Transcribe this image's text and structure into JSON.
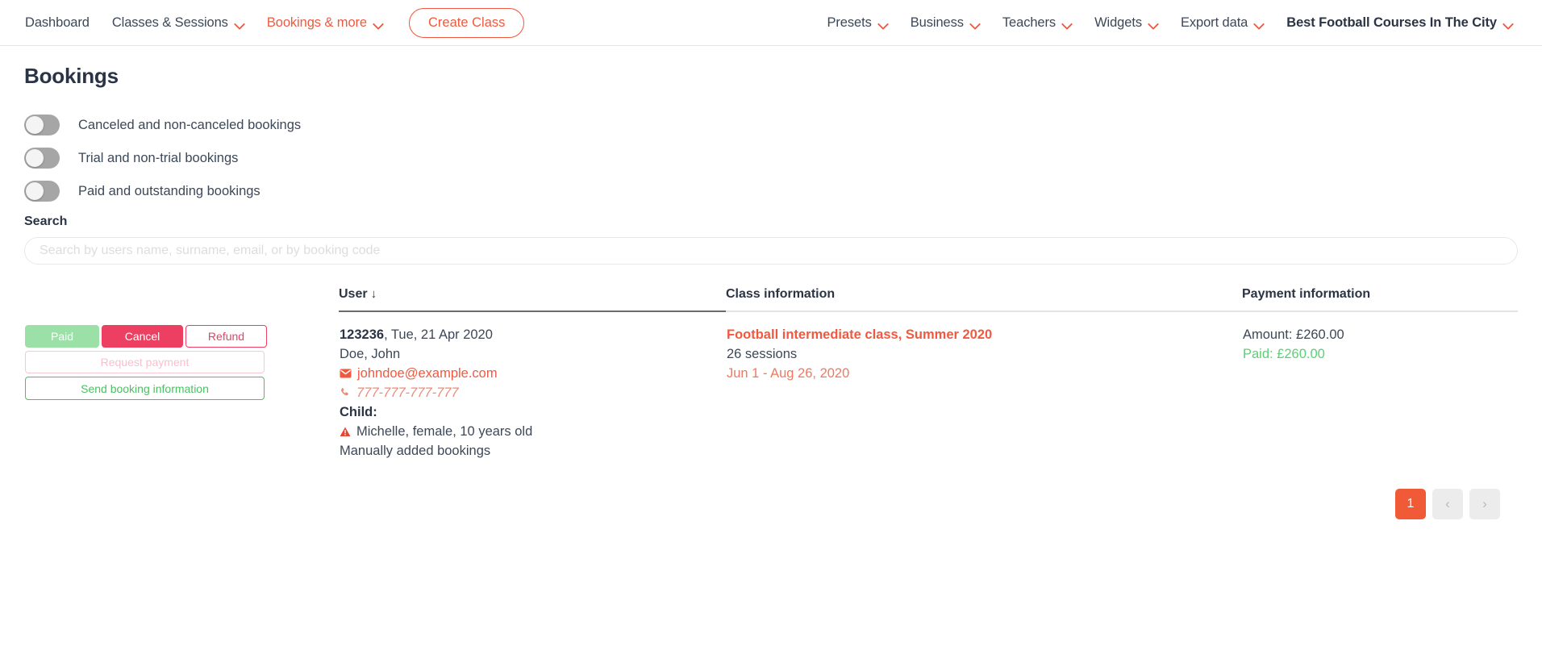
{
  "nav": {
    "left_items": [
      {
        "label": "Dashboard",
        "caret": false,
        "accent": false,
        "bold": false
      },
      {
        "label": "Classes & Sessions",
        "caret": true,
        "accent": false,
        "bold": false
      },
      {
        "label": "Bookings & more",
        "caret": true,
        "accent": true,
        "bold": false
      }
    ],
    "create_button": "Create Class",
    "right_items": [
      {
        "label": "Presets",
        "caret": true,
        "accent": false,
        "bold": false
      },
      {
        "label": "Business",
        "caret": true,
        "accent": false,
        "bold": false
      },
      {
        "label": "Teachers",
        "caret": true,
        "accent": false,
        "bold": false
      },
      {
        "label": "Widgets",
        "caret": true,
        "accent": false,
        "bold": false
      },
      {
        "label": "Export data",
        "caret": true,
        "accent": false,
        "bold": false
      },
      {
        "label": "Best Football Courses In The City",
        "caret": true,
        "accent": false,
        "bold": true
      }
    ]
  },
  "page": {
    "title": "Bookings"
  },
  "toggles": [
    {
      "label": "Canceled and non-canceled bookings",
      "on": false
    },
    {
      "label": "Trial and non-trial bookings",
      "on": false
    },
    {
      "label": "Paid and outstanding bookings",
      "on": false
    }
  ],
  "search": {
    "label": "Search",
    "placeholder": "Search by users name, surname, email, or by booking code",
    "value": ""
  },
  "table": {
    "headers": {
      "actions": "",
      "user": "User",
      "user_sort_arrow": "↓",
      "class": "Class information",
      "payment": "Payment information"
    },
    "row": {
      "actions": {
        "paid": "Paid",
        "cancel": "Cancel",
        "refund": "Refund",
        "request_payment": "Request payment",
        "send_booking_information": "Send booking information"
      },
      "user": {
        "booking_code": "123236",
        "booking_date": ", Tue, 21 Apr 2020",
        "name": "Doe, John",
        "email": "johndoe@example.com",
        "phone": "777-777-777-777",
        "child_label": "Child:",
        "child_details": "Michelle, female, 10 years old",
        "source": "Manually added bookings"
      },
      "class": {
        "title": "Football intermediate class, Summer 2020",
        "sessions": "26 sessions",
        "dates": "Jun 1 - Aug 26, 2020"
      },
      "payment": {
        "amount": "Amount: £260.00",
        "paid": "Paid: £260.00"
      }
    }
  },
  "pagination": {
    "current_page": "1",
    "prev": "‹",
    "next": "›"
  },
  "colors": {
    "accent": "#f0593f",
    "danger": "#ec3f62",
    "success": "#4cbf62",
    "paid_green": "#5bd075",
    "pager_active": "#f05a36"
  }
}
